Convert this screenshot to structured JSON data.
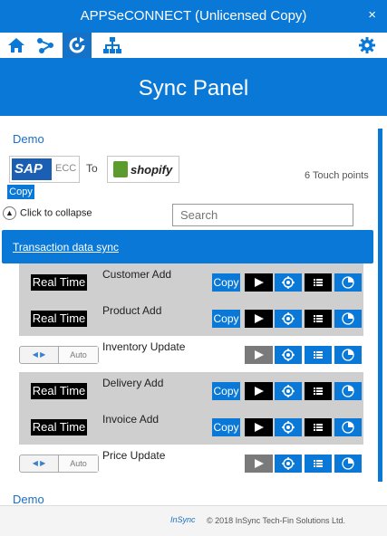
{
  "window": {
    "title": "APPSeCONNECT (Unlicensed Copy)",
    "close": "×"
  },
  "toolbar": {
    "home": "home-icon",
    "connect": "connections-icon",
    "sync": "sync-icon",
    "org": "hierarchy-icon",
    "settings": "gear-icon"
  },
  "header": {
    "title": "Sync Panel"
  },
  "connection": {
    "group_label": "Demo",
    "source_logo": "SAP",
    "source_sub": "ECC",
    "to_label": "To",
    "target_logo": "shopify",
    "touch_points": "6 Touch points",
    "copy_label": "Copy",
    "collapse_label": "Click to collapse",
    "search_placeholder": "Search"
  },
  "section": {
    "title": "Transaction data sync"
  },
  "processes": [
    {
      "mode": "Real Time",
      "name": "Customer Add",
      "copy": "Copy",
      "enabled": true
    },
    {
      "mode": "Real Time",
      "name": "Product Add",
      "copy": "Copy",
      "enabled": true
    },
    {
      "mode": "Auto",
      "name": "Inventory Update",
      "copy": "",
      "enabled": false
    },
    {
      "mode": "Real Time",
      "name": "Delivery Add",
      "copy": "Copy",
      "enabled": true
    },
    {
      "mode": "Real Time",
      "name": "Invoice Add",
      "copy": "Copy",
      "enabled": true
    },
    {
      "mode": "Auto",
      "name": "Price Update",
      "copy": "",
      "enabled": false
    }
  ],
  "next_group": {
    "label": "Demo"
  },
  "footer": {
    "brand": "InSync",
    "copyright": "©  2018 InSync Tech-Fin Solutions Ltd."
  },
  "colors": {
    "accent": "#0a78d6",
    "band": "#cfcfcf",
    "disabled_play": "#7a7a7a"
  }
}
